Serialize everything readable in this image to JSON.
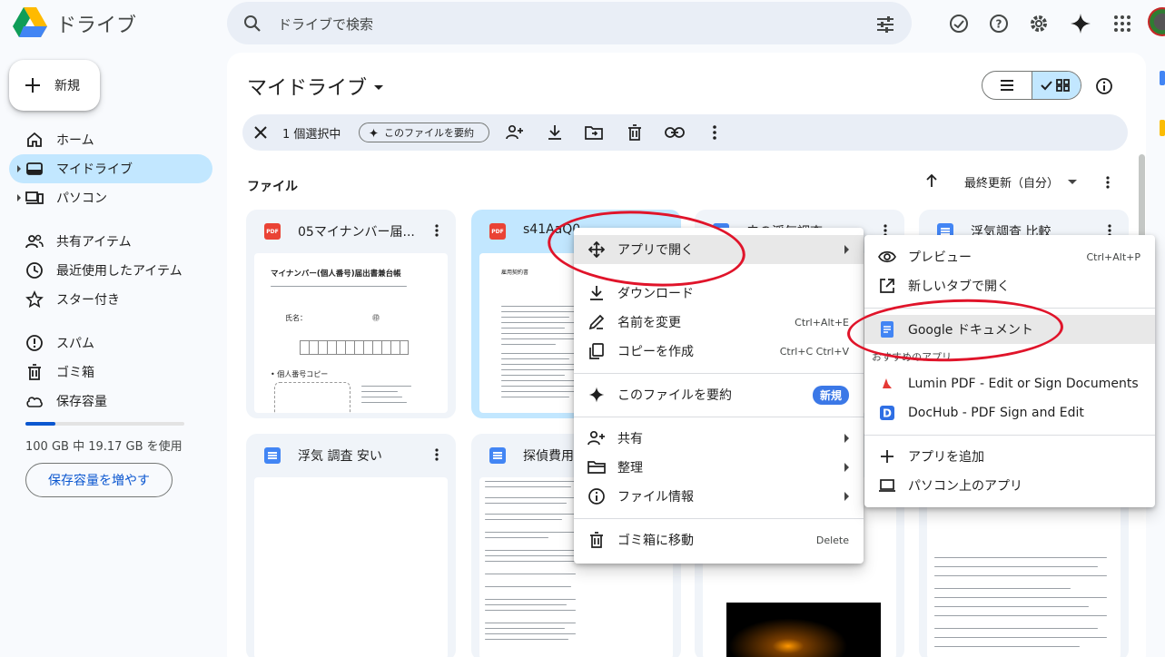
{
  "app": {
    "name": "ドライブ"
  },
  "search": {
    "placeholder": "ドライブで検索"
  },
  "sidebar": {
    "new_label": "新規",
    "items": [
      {
        "label": "ホーム",
        "icon": "home-icon"
      },
      {
        "label": "マイドライブ",
        "icon": "drive-icon",
        "active": true
      },
      {
        "label": "パソコン",
        "icon": "computer-icon"
      },
      {
        "label": "共有アイテム",
        "icon": "people-icon"
      },
      {
        "label": "最近使用したアイテム",
        "icon": "clock-icon"
      },
      {
        "label": "スター付き",
        "icon": "star-icon"
      },
      {
        "label": "スパム",
        "icon": "spam-icon"
      },
      {
        "label": "ゴミ箱",
        "icon": "trash-icon"
      },
      {
        "label": "保存容量",
        "icon": "cloud-icon"
      }
    ],
    "storage_text": "100 GB 中 19.17 GB を使用",
    "storage_fraction": 0.19,
    "storage_button": "保存容量を増やす"
  },
  "main": {
    "title": "マイドライブ",
    "selection": {
      "count_label": "1 個選択中",
      "summarize_chip": "このファイルを要約"
    },
    "files_label": "ファイル",
    "sort_label": "最終更新（自分）",
    "cards": [
      {
        "name": "05マイナンバー届...",
        "type": "pdf",
        "type_label": "PDF",
        "thumb_title": "マイナンバー(個人番号)届出書兼台帳",
        "thumb_name": "氏名：",
        "thumb_stamp": "㊞",
        "thumb_section": "• 個人番号コピー",
        "selected": false
      },
      {
        "name": "s41AaQ0...",
        "type": "pdf",
        "type_label": "PDF",
        "thumb_title": "雇用契約書",
        "selected": true
      },
      {
        "name": "夫の浮気調査...",
        "type": "doc",
        "selected": false
      },
      {
        "name": "浮気調査 比較",
        "type": "doc",
        "selected": false
      },
      {
        "name": "浮気 調査 安い",
        "type": "doc",
        "selected": false
      },
      {
        "name": "探偵費用...",
        "type": "doc",
        "selected": false
      },
      {
        "name": "",
        "type": "doc",
        "selected": false
      },
      {
        "name": "",
        "type": "doc",
        "selected": false
      }
    ]
  },
  "context_menu": {
    "items": [
      {
        "label": "アプリで開く",
        "icon": "move-icon",
        "submenu": true
      },
      {
        "label": "ダウンロード",
        "icon": "download-icon"
      },
      {
        "label": "名前を変更",
        "icon": "edit-icon",
        "shortcut": "Ctrl+Alt+E"
      },
      {
        "label": "コピーを作成",
        "icon": "copy-icon",
        "shortcut": "Ctrl+C Ctrl+V"
      },
      {
        "label": "このファイルを要約",
        "icon": "sparkle-icon",
        "badge": "新規"
      },
      {
        "label": "共有",
        "icon": "share-icon",
        "submenu": true
      },
      {
        "label": "整理",
        "icon": "folder-icon",
        "submenu": true
      },
      {
        "label": "ファイル情報",
        "icon": "info-icon",
        "submenu": true
      },
      {
        "label": "ゴミ箱に移動",
        "icon": "trash-icon",
        "shortcut": "Delete"
      }
    ]
  },
  "submenu": {
    "items": [
      {
        "label": "プレビュー",
        "icon": "eye-icon",
        "shortcut": "Ctrl+Alt+P"
      },
      {
        "label": "新しいタブで開く",
        "icon": "open-new-icon"
      },
      {
        "label": "Google ドキュメント",
        "icon": "docs-icon"
      },
      {
        "label": "Lumin PDF - Edit or Sign Documents",
        "icon": "lumin-icon"
      },
      {
        "label": "DocHub - PDF Sign and Edit",
        "icon": "dochub-icon"
      },
      {
        "label": "アプリを追加",
        "icon": "plus-icon"
      },
      {
        "label": "パソコン上のアプリ",
        "icon": "laptop-icon"
      }
    ],
    "section_label": "おすすめのアプリ"
  },
  "colors": {
    "accent": "#0b57d0",
    "active_bg": "#c2e7ff",
    "annotation": "#e0142a"
  }
}
